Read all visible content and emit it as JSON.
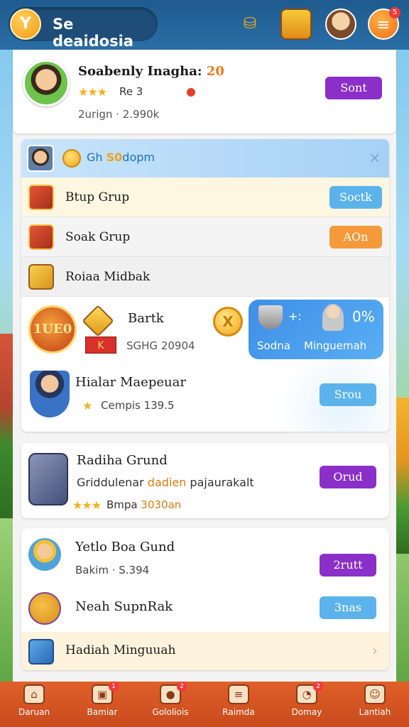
{
  "header": {
    "title": "Se deaidosia",
    "logo_glyph": "Y",
    "notify_count": "5",
    "icons": [
      "coins-icon",
      "treasure-chest-icon",
      "avatar-icon",
      "notification-icon"
    ]
  },
  "profile": {
    "name": "Soabenly Inagha:",
    "level": "20",
    "rank": "Re 3",
    "stat": "2urign · 2.990k",
    "button": "Sont"
  },
  "group_card": {
    "title_prefix": "Gh",
    "title_accent": "S0",
    "title_suffix": "dopm",
    "close_glyph": "×",
    "rows": [
      {
        "label": "Btup Grup",
        "button": "Soctk",
        "button_color": "#5cb3ec"
      },
      {
        "label": "Soak Grup",
        "button": "AOn",
        "button_color": "#f59a3a"
      },
      {
        "label": "Roiaa Midbak"
      }
    ],
    "promo": {
      "badge_text": "1UE0",
      "name": "Bartk",
      "tag": "K",
      "sub": "SGHG 20904",
      "coin_glyph": "X",
      "plus_glyph": "+:",
      "percent": "0%",
      "caption_left": "Sodna",
      "caption_right": "Minguemah"
    },
    "hero": {
      "name": "Hialar Maepeuar",
      "stars": "★",
      "sub": "Cempis 139.5",
      "button": "Srou"
    }
  },
  "reward_card": {
    "title": "Radiha Grund",
    "sub_prefix": "Griddulenar",
    "sub_accent": "dadien",
    "sub_suffix": "pajaurakalt",
    "stars": "★★★",
    "stars_prefix": "Bmpa",
    "stars_accent": "3030an",
    "button": "Orud"
  },
  "bottom_card": {
    "rows": [
      {
        "title": "Yetlo Boa Gund",
        "sub": "Bakim · S.394",
        "button": "2rutt",
        "button_color": "#8a2fc8"
      },
      {
        "title": "Neah SupnRak",
        "button": "3nas",
        "button_color": "#5cb3ec"
      }
    ],
    "footer_label": "Hadiah Minguuah",
    "footer_chevron": "›"
  },
  "bottom_nav": [
    {
      "label": "Daruan",
      "icon": "home-icon",
      "glyph": "⌂"
    },
    {
      "label": "Bamiar",
      "icon": "box-icon",
      "glyph": "▣",
      "badge": "1"
    },
    {
      "label": "Gololiois",
      "icon": "smiley-icon",
      "glyph": "●",
      "badge": "2"
    },
    {
      "label": "Raimda",
      "icon": "clipboard-icon",
      "glyph": "≡"
    },
    {
      "label": "Domay",
      "icon": "chat-icon",
      "glyph": "◔",
      "badge": "2"
    },
    {
      "label": "Lantiah",
      "icon": "user-icon",
      "glyph": "☺"
    }
  ],
  "colors": {
    "accent_purple": "#8a2fc8",
    "accent_blue": "#5cb3ec",
    "accent_orange": "#f59a3a",
    "nav_bg": "#d9552a",
    "header_bg": "#1f5b8e"
  }
}
